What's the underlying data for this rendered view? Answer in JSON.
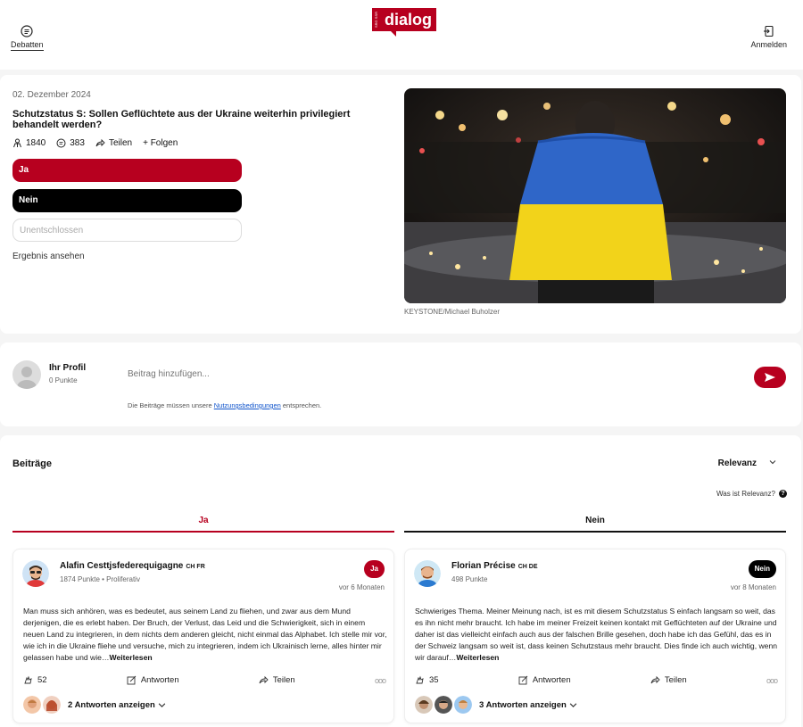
{
  "header": {
    "nav_left_label": "Debatten",
    "nav_right_label": "Anmelden",
    "logo_text": "dialog",
    "logo_tag": "SRG SSR"
  },
  "debate": {
    "date": "02. Dezember 2024",
    "title": "Schutzstatus S: Sollen Geflüchtete aus der Ukraine weiterhin privilegiert behandelt werden?",
    "participants": "1840",
    "comments": "383",
    "share_label": "Teilen",
    "follow_label": "+ Folgen",
    "options": [
      "Ja",
      "Nein",
      "Unentschlossen"
    ],
    "result_link": "Ergebnis ansehen",
    "photo_credit": "KEYSTONE/Michael Buholzer"
  },
  "composer": {
    "profile_name": "Ihr Profil",
    "profile_points": "0 Punkte",
    "placeholder": "Beitrag hinzufügen...",
    "terms_prefix": "Die Beiträge müssen unsere",
    "terms_link": "Nutzungsbedingungen",
    "terms_suffix": "entsprechen."
  },
  "posts": {
    "heading": "Beiträge",
    "sort_value": "Relevanz",
    "relevance_question": "Was ist Relevanz?",
    "tab_ja": "Ja",
    "tab_nein": "Nein",
    "items": [
      {
        "name": "Alafin Cesttjsfederequigagne",
        "tags": "CH FR",
        "points": "1874 Punkte • Proliferativ",
        "badge": "Ja",
        "time": "vor 6 Monaten",
        "text": "Man muss sich anhören, was es bedeutet, aus seinem Land zu fliehen, und zwar aus dem Mund derjenigen, die es erlebt haben. Der Bruch, der Verlust, das Leid und die Schwierigkeit, sich in einem neuen Land zu integrieren, in dem nichts dem anderen gleicht, nicht einmal das Alphabet. Ich stelle mir vor, wie ich in die Ukraine fliehe und versuche, mich zu integrieren, indem ich Ukrainisch lerne, alles hinter mir gelassen habe und wie…",
        "more": "Weiterlesen",
        "likes": "52",
        "reply_label": "Antworten",
        "share_label": "Teilen",
        "dots": "ooo",
        "replies_label": "2 Antworten anzeigen"
      },
      {
        "name": "Florian Précise",
        "tags": "CH DE",
        "points": "498 Punkte",
        "badge": "Nein",
        "time": "vor 8 Monaten",
        "text": "Schwieriges Thema. Meiner Meinung nach, ist es mit diesem Schutzstatus S einfach langsam so weit, das es ihn nicht mehr braucht. Ich habe im meiner Freizeit keinen kontakt mit Geflüchteten auf der Ukraine und daher ist das vielleicht einfach auch aus der falschen Brille gesehen, doch habe ich das Gefühl, das es in der Schweiz langsam so weit ist, dass keinen Schutzstaus mehr braucht. Dies finde ich auch wichtig, wenn wir darauf…",
        "more": "Weiterlesen",
        "likes": "35",
        "reply_label": "Antworten",
        "share_label": "Teilen",
        "dots": "ooo",
        "replies_label": "3 Antworten anzeigen"
      }
    ]
  },
  "colors": {
    "brand_red": "#b7001f",
    "black": "#000000"
  }
}
